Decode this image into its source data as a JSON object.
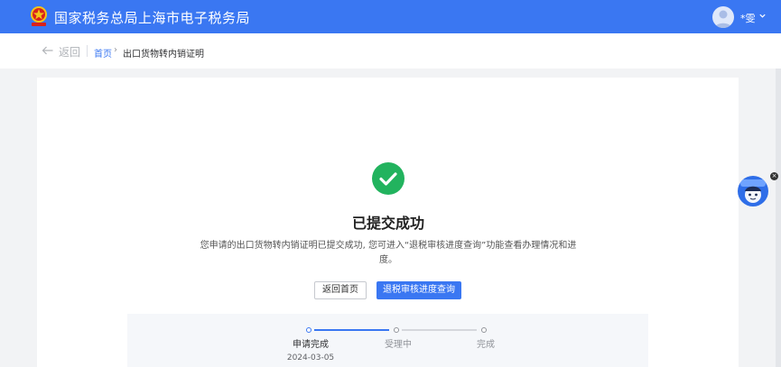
{
  "header": {
    "site_title": "国家税务总局上海市电子税务局",
    "user_name": "*雯",
    "brand_color": "#3a77f2",
    "icons": [
      "tax-emblem-icon",
      "user-avatar-icon",
      "chevron-down-icon"
    ]
  },
  "navbar": {
    "back_label": "返回",
    "breadcrumb_home": "首页",
    "breadcrumb_current": "出口货物转内销证明"
  },
  "result": {
    "status_color": "#22b35e",
    "title": "已提交成功",
    "description": "您申请的出口货物转内销证明已提交成功, 您可进入“退税审核进度查询”功能查看办理情况和进度。",
    "buttons": {
      "home": "返回首页",
      "query": "退税审核进度查询"
    }
  },
  "steps": {
    "items": [
      {
        "label": "申请完成",
        "status": "done",
        "date": "2024-03-05"
      },
      {
        "label": "受理中",
        "status": "pending"
      },
      {
        "label": "完成",
        "status": "pending"
      }
    ]
  }
}
